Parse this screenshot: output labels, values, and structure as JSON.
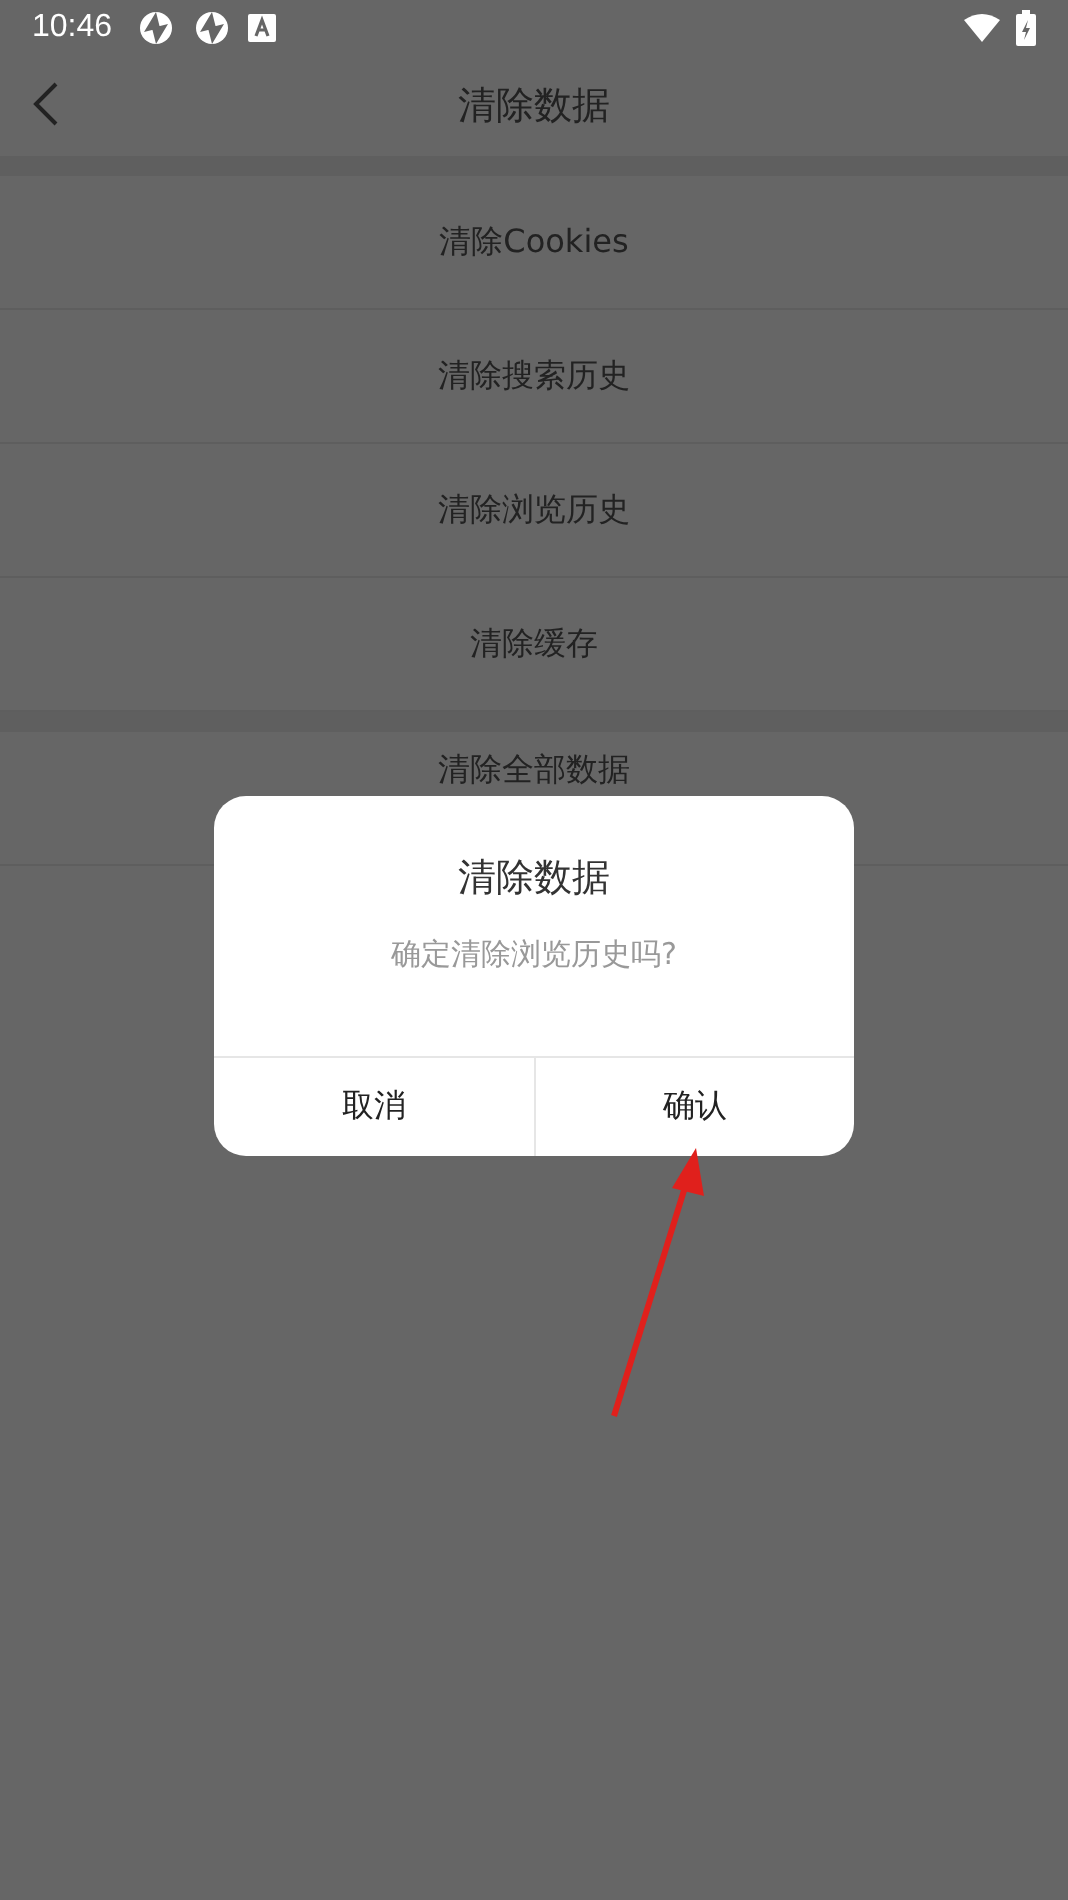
{
  "status_bar": {
    "time": "10:46"
  },
  "header": {
    "title": "清除数据"
  },
  "groups": [
    {
      "items": [
        {
          "label": "清除Cookies"
        },
        {
          "label": "清除搜索历史"
        },
        {
          "label": "清除浏览历史"
        },
        {
          "label": "清除缓存"
        }
      ]
    },
    {
      "items": [
        {
          "label": "清除全部数据"
        }
      ]
    }
  ],
  "dialog": {
    "title": "清除数据",
    "message": "确定清除浏览历史吗?",
    "buttons": [
      {
        "label": "取消"
      },
      {
        "label": "确认"
      }
    ]
  },
  "annotation": {
    "kind": "arrow"
  }
}
